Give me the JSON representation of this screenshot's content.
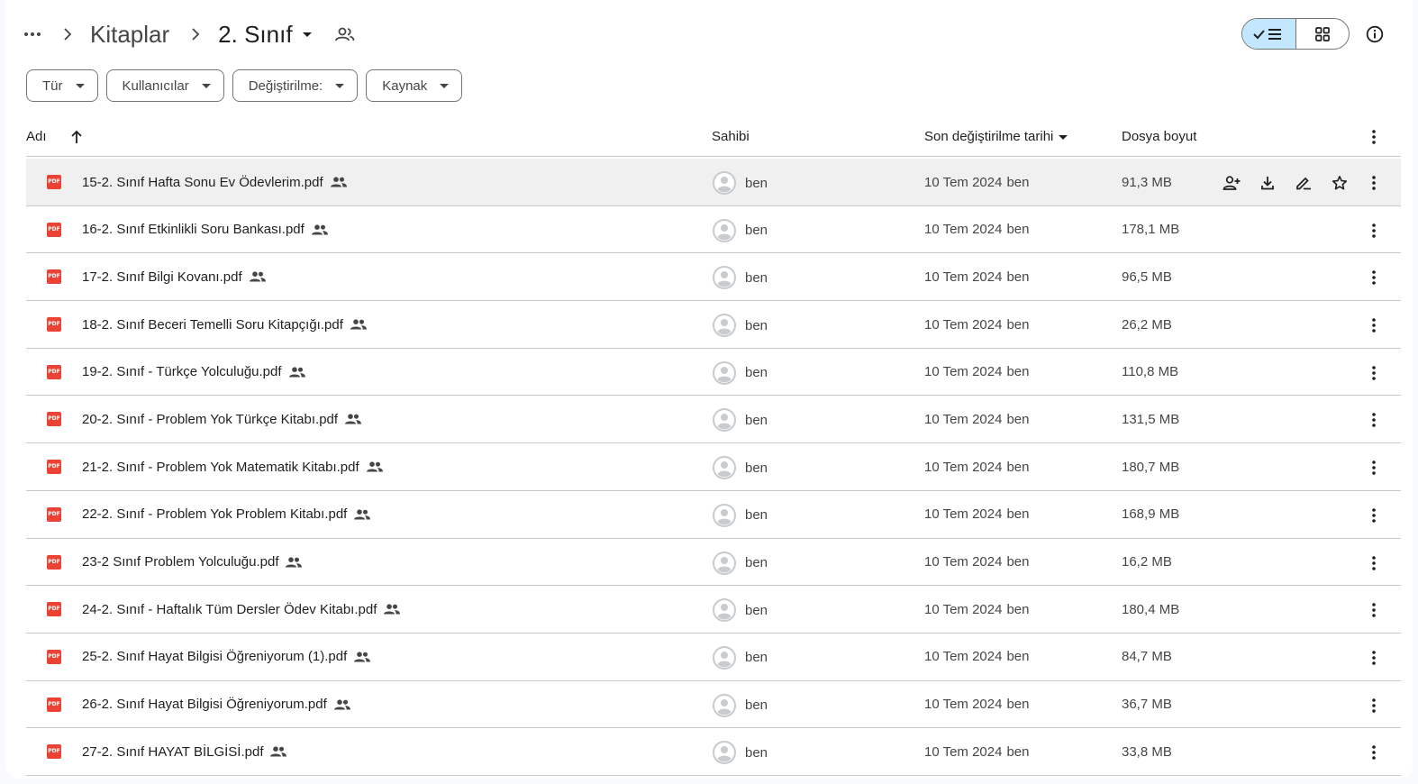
{
  "breadcrumb": {
    "more_icon": "more-horiz-icon",
    "items": [
      "Kitaplar",
      "2. Sınıf"
    ]
  },
  "filters": [
    "Tür",
    "Kullanıcılar",
    "Değiştirilme:",
    "Kaynak"
  ],
  "columns": {
    "name": "Adı",
    "owner": "Sahibi",
    "modified": "Son değiştirilme tarihi",
    "size": "Dosya boyut"
  },
  "colors": {
    "pdf": "#ea4335",
    "toggle_active": "#c2e7ff",
    "divider": "#c7c7c7"
  },
  "files": [
    {
      "name": "15-2. Sınıf Hafta Sonu Ev Ödevlerim.pdf",
      "owner": "ben",
      "date": "10 Tem 2024",
      "by": "ben",
      "size": "91,3 MB"
    },
    {
      "name": "16-2. Sınıf Etkinlikli Soru Bankası.pdf",
      "owner": "ben",
      "date": "10 Tem 2024",
      "by": "ben",
      "size": "178,1 MB"
    },
    {
      "name": "17-2. Sınıf Bilgi Kovanı.pdf",
      "owner": "ben",
      "date": "10 Tem 2024",
      "by": "ben",
      "size": "96,5 MB"
    },
    {
      "name": "18-2. Sınıf Beceri Temelli Soru Kitapçığı.pdf",
      "owner": "ben",
      "date": "10 Tem 2024",
      "by": "ben",
      "size": "26,2 MB"
    },
    {
      "name": "19-2. Sınıf - Türkçe Yolculuğu.pdf",
      "owner": "ben",
      "date": "10 Tem 2024",
      "by": "ben",
      "size": "110,8 MB"
    },
    {
      "name": "20-2. Sınıf - Problem Yok Türkçe Kitabı.pdf",
      "owner": "ben",
      "date": "10 Tem 2024",
      "by": "ben",
      "size": "131,5 MB"
    },
    {
      "name": "21-2. Sınıf - Problem Yok Matematik Kitabı.pdf",
      "owner": "ben",
      "date": "10 Tem 2024",
      "by": "ben",
      "size": "180,7 MB"
    },
    {
      "name": "22-2. Sınıf - Problem Yok Problem Kitabı.pdf",
      "owner": "ben",
      "date": "10 Tem 2024",
      "by": "ben",
      "size": "168,9 MB"
    },
    {
      "name": "23-2 Sınıf Problem Yolculuğu.pdf",
      "owner": "ben",
      "date": "10 Tem 2024",
      "by": "ben",
      "size": "16,2 MB"
    },
    {
      "name": "24-2. Sınıf - Haftalık Tüm Dersler Ödev Kitabı.pdf",
      "owner": "ben",
      "date": "10 Tem 2024",
      "by": "ben",
      "size": "180,4 MB"
    },
    {
      "name": "25-2. Sınıf Hayat Bilgisi Öğreniyorum (1).pdf",
      "owner": "ben",
      "date": "10 Tem 2024",
      "by": "ben",
      "size": "84,7 MB"
    },
    {
      "name": "26-2. Sınıf Hayat Bilgisi Öğreniyorum.pdf",
      "owner": "ben",
      "date": "10 Tem 2024",
      "by": "ben",
      "size": "36,7 MB"
    },
    {
      "name": "27-2. Sınıf HAYAT BİLGİSİ.pdf",
      "owner": "ben",
      "date": "10 Tem 2024",
      "by": "ben",
      "size": "33,8 MB"
    }
  ]
}
